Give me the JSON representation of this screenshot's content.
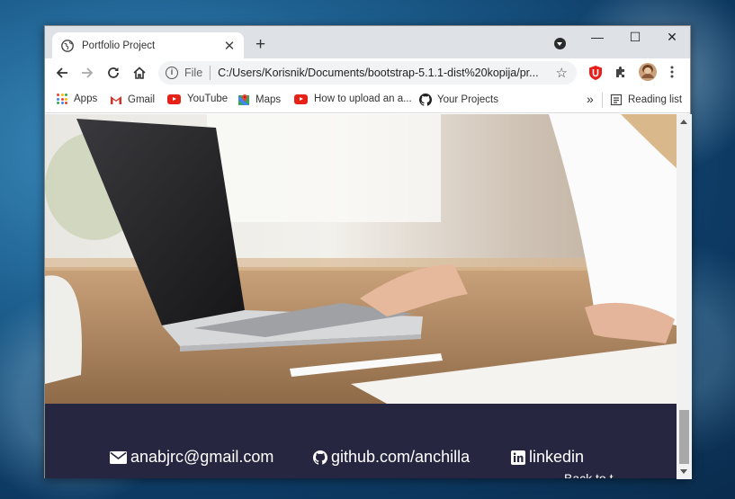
{
  "browser": {
    "tab_title": "Portfolio Project",
    "tab_close": "✕",
    "new_tab": "+",
    "window_controls": {
      "minimize": "—",
      "maximize": "☐",
      "close": "✕"
    },
    "address": {
      "info_glyph": "i",
      "scheme_label": "File",
      "url": "C:/Users/Korisnik/Documents/bootstrap-5.1.1-dist%20kopija/pr..."
    },
    "bookmarks": [
      {
        "label": "Apps",
        "icon": "apps-grid-icon"
      },
      {
        "label": "Gmail",
        "icon": "gmail-icon"
      },
      {
        "label": "YouTube",
        "icon": "youtube-icon"
      },
      {
        "label": "Maps",
        "icon": "maps-icon"
      },
      {
        "label": "How to upload an a...",
        "icon": "youtube-icon"
      },
      {
        "label": "Your Projects",
        "icon": "github-icon"
      }
    ],
    "bookmarks_overflow": "»",
    "reading_list": "Reading list"
  },
  "page": {
    "footer": {
      "email": "anabjrc@gmail.com",
      "github": "github.com/anchilla",
      "linkedin": "linkedin",
      "partial_text": "Back to t"
    }
  },
  "colors": {
    "footer_bg": "#272640",
    "tabstrip_bg": "#dee1e6",
    "omnibox_bg": "#f1f3f4",
    "extension_red": "#e8201b"
  }
}
